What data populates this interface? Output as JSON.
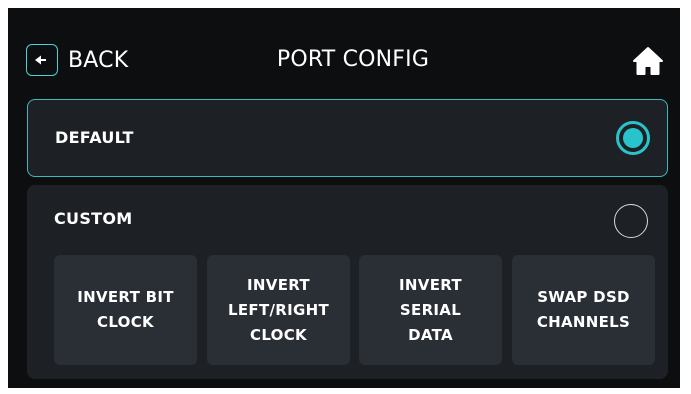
{
  "header": {
    "back_label": "BACK",
    "title": "PORT CONFIG",
    "back_icon": "arrow-left-icon",
    "home_icon": "home-icon"
  },
  "options": {
    "default": {
      "label": "DEFAULT",
      "selected": true
    },
    "custom": {
      "label": "CUSTOM",
      "selected": false,
      "buttons": [
        {
          "label": "INVERT BIT\nCLOCK"
        },
        {
          "label": "INVERT\nLEFT/RIGHT\nCLOCK"
        },
        {
          "label": "INVERT\nSERIAL\nDATA"
        },
        {
          "label": "SWAP DSD\nCHANNELS"
        }
      ]
    }
  },
  "colors": {
    "background": "#0d0e10",
    "panel": "#1d2126",
    "sub_button": "#2a2e35",
    "accent": "#29c3cc",
    "text": "#ffffff"
  }
}
